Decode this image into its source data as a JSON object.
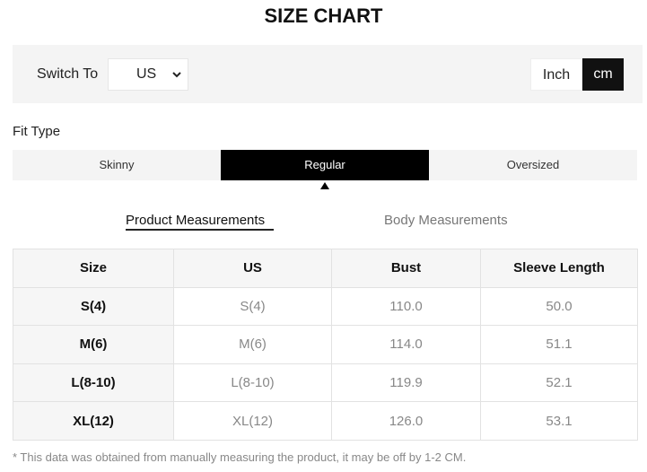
{
  "title": "SIZE CHART",
  "switch": {
    "label": "Switch To",
    "selected_region": "US",
    "units": [
      "Inch",
      "cm"
    ],
    "active_unit": "cm"
  },
  "fit": {
    "label": "Fit Type",
    "options": [
      "Skinny",
      "Regular",
      "Oversized"
    ],
    "active": "Regular"
  },
  "measurement_tabs": {
    "product": "Product Measurements",
    "body": "Body Measurements",
    "active": "product"
  },
  "table": {
    "headers": [
      "Size",
      "US",
      "Bust",
      "Sleeve Length"
    ],
    "rows": [
      [
        "S(4)",
        "S(4)",
        "110.0",
        "50.0"
      ],
      [
        "M(6)",
        "M(6)",
        "114.0",
        "51.1"
      ],
      [
        "L(8-10)",
        "L(8-10)",
        "119.9",
        "52.1"
      ],
      [
        "XL(12)",
        "XL(12)",
        "126.0",
        "53.1"
      ]
    ]
  },
  "note": "* This data was obtained from manually measuring the product, it may be off by 1-2 CM."
}
